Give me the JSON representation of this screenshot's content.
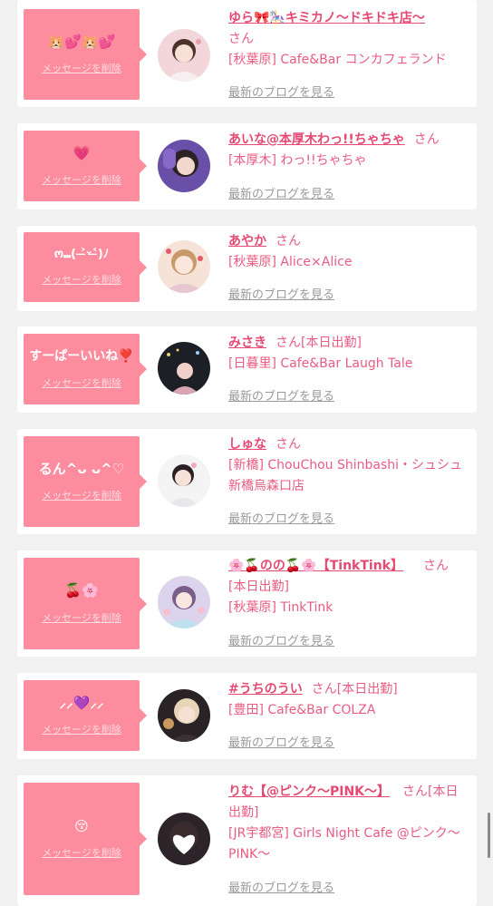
{
  "theme": {
    "accent": "#fd8d9e",
    "name_color": "#e54a73",
    "muted": "#9a9a9a",
    "background": "#f1f1f1"
  },
  "common": {
    "delete_label": "メッセージを削除",
    "blog_label": "最新のブログを見る"
  },
  "messages": [
    {
      "bubble_text": "🐹💕🐹💕",
      "name": "ゆら🎀🎠キミカノ〜ドキドキ店〜",
      "suffix": "さん",
      "shop_line": "[秋葉原] Cafe&Bar コンカフェランド",
      "avatar_icon": "girl-portrait-icon"
    },
    {
      "bubble_text": "💗",
      "name": "あいな@本厚木わっ!!ちゃちゃ",
      "suffix": "さん",
      "shop_line": "[本厚木] わっ!!ちゃちゃ",
      "avatar_icon": "girl-portrait-icon"
    },
    {
      "bubble_text": "ო⑉( ˃̶ᵕ˂̶)ﾉ",
      "name": "あやか",
      "suffix": "さん",
      "shop_line": "[秋葉原] Alice×Alice",
      "avatar_icon": "girl-portrait-icon"
    },
    {
      "bubble_text": "すーぱーいいね❣️",
      "name": "みさき",
      "suffix": "さん[本日出勤]",
      "shop_line": "[日暮里] Cafe&Bar Laugh Tale",
      "avatar_icon": "girl-portrait-icon"
    },
    {
      "bubble_text": "るん^ᴗ ᴗ^♡",
      "name": "しゅな",
      "suffix": "さん",
      "shop_line": "[新橋] ChouChou Shinbashi・シュシュ新橋烏森口店",
      "avatar_icon": "girl-portrait-icon"
    },
    {
      "bubble_text": "🍒🌸",
      "name": "🌸🍒のの🍒🌸【TinkTink】",
      "suffix": "さん",
      "status_line": "[本日出勤]",
      "shop_line": "[秋葉原] TinkTink",
      "avatar_icon": "girl-portrait-icon"
    },
    {
      "bubble_text": "⸝⸝💜⸝⸝",
      "name": "#うちのうい",
      "suffix": "さん[本日出勤]",
      "shop_line": "[豊田] Cafe&Bar COLZA",
      "avatar_icon": "girl-portrait-icon"
    },
    {
      "bubble_text": "😚",
      "name": "りむ【@ピンク〜PINK〜】",
      "suffix": "さん[本日出勤]",
      "shop_line": "[JR宇都宮] Girls Night Cafe @ピンク〜PINK〜",
      "avatar_icon": "girl-portrait-heart-icon"
    }
  ]
}
